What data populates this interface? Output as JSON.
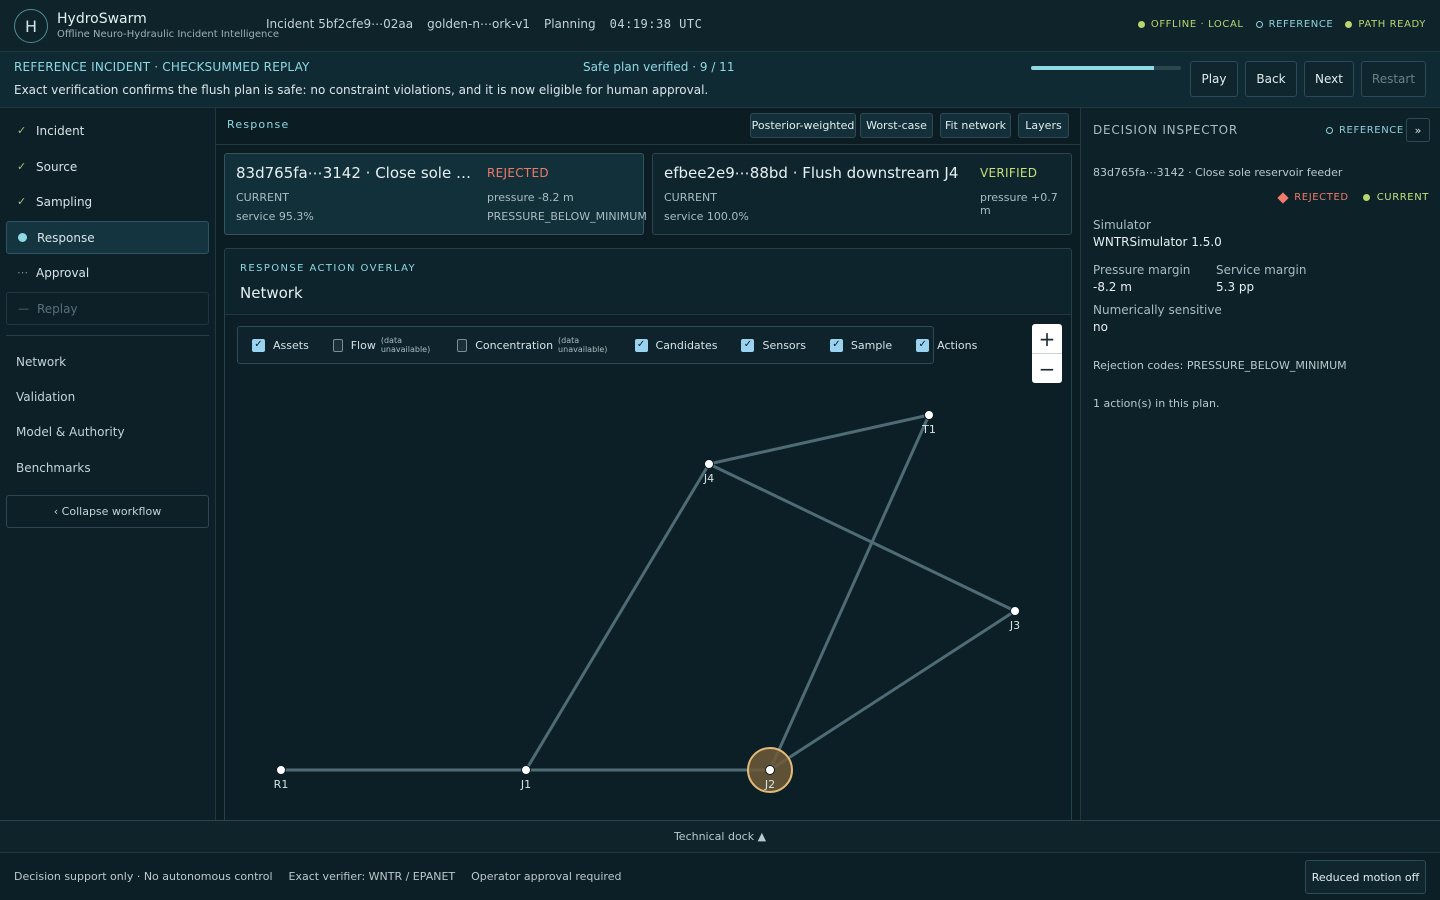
{
  "app": {
    "logo_letter": "H",
    "title": "HydroSwarm",
    "subtitle": "Offline Neuro-Hydraulic Incident Intelligence",
    "incident": "Incident 5bf2cfe9⋯02aa",
    "scenario": "golden-n⋯ork-v1",
    "phase": "Planning",
    "clock": "04:19:38 UTC",
    "status": {
      "offline": "OFFLINE · LOCAL",
      "reference": "REFERENCE",
      "path": "PATH READY"
    },
    "colors": {
      "accent": "#8fd8e4",
      "ok": "#b8d56e",
      "rejected": "#f07a6a",
      "verified": "#c9df7c"
    }
  },
  "banner": {
    "label": "REFERENCE INCIDENT · CHECKSUMMED REPLAY",
    "message": "Exact verification confirms the flush plan is safe: no constraint violations, and it is now eligible for human approval.",
    "progress_text": "Safe plan verified · 9 / 11",
    "progress_fraction": 0.818,
    "buttons": {
      "play": "Play",
      "back": "Back",
      "next": "Next",
      "restart": "Restart"
    }
  },
  "sidebar": {
    "workflow": [
      {
        "label": "Incident",
        "mark": "✓",
        "state": "done"
      },
      {
        "label": "Source",
        "mark": "✓",
        "state": "done"
      },
      {
        "label": "Sampling",
        "mark": "✓",
        "state": "done"
      },
      {
        "label": "Response",
        "mark": "",
        "state": "active"
      },
      {
        "label": "Approval",
        "mark": "⋯",
        "state": "pending"
      },
      {
        "label": "Replay",
        "mark": "—",
        "state": "disabled"
      }
    ],
    "links": [
      "Network",
      "Validation",
      "Model & Authority",
      "Benchmarks"
    ],
    "collapse_label": "‹ Collapse workflow"
  },
  "main": {
    "title": "Response",
    "tools": [
      "Posterior-weighted",
      "Worst-case",
      "Fit network",
      "Layers"
    ],
    "candidates": [
      {
        "title": "83d765fa⋯3142 · Close sole r⋯",
        "state": "CURRENT",
        "service": "service 95.3%",
        "verdict": "REJECTED",
        "pressure": "pressure -8.2 m",
        "code": "PRESSURE_BELOW_MINIMUM"
      },
      {
        "title": "efbee2e9⋯88bd · Flush downstream J4",
        "state": "CURRENT",
        "service": "service 100.0%",
        "verdict": "VERIFIED",
        "pressure": "pressure +0.7 m",
        "code": ""
      }
    ],
    "overlay": {
      "label": "RESPONSE ACTION OVERLAY",
      "title": "Network",
      "layers": [
        {
          "label": "Assets",
          "checked": true,
          "note": ""
        },
        {
          "label": "Flow",
          "checked": false,
          "note": "(data unavailable)"
        },
        {
          "label": "Concentration",
          "checked": false,
          "note": "(data unavailable)"
        },
        {
          "label": "Candidates",
          "checked": true,
          "note": ""
        },
        {
          "label": "Sensors",
          "checked": true,
          "note": ""
        },
        {
          "label": "Sample",
          "checked": true,
          "note": ""
        },
        {
          "label": "Actions",
          "checked": true,
          "note": ""
        }
      ],
      "zoom_in": "+",
      "zoom_out": "−",
      "network": {
        "nodes": [
          "R1",
          "J1",
          "J2",
          "J3",
          "J4",
          "T1"
        ],
        "edges": [
          [
            "R1",
            "J1"
          ],
          [
            "J1",
            "J2"
          ],
          [
            "J1",
            "J4"
          ],
          [
            "J4",
            "T1"
          ],
          [
            "J4",
            "J3"
          ],
          [
            "J2",
            "T1"
          ],
          [
            "J2",
            "J3"
          ]
        ],
        "highlighted_node": "J2"
      }
    }
  },
  "inspector": {
    "title": "DECISION INSPECTOR",
    "reference": "REFERENCE",
    "expand": "»",
    "subtitle": "83d765fa⋯3142 · Close sole reservoir feeder",
    "tag_rejected": "REJECTED",
    "tag_current": "CURRENT",
    "simulator_label": "Simulator",
    "simulator_value": "WNTRSimulator 1.5.0",
    "pressure_label": "Pressure margin",
    "pressure_value": "-8.2 m",
    "service_label": "Service margin",
    "service_value": "5.3 pp",
    "sensitive_label": "Numerically sensitive",
    "sensitive_value": "no",
    "rejection": "Rejection codes: PRESSURE_BELOW_MINIMUM",
    "actions": "1 action(s) in this plan."
  },
  "dock": {
    "label": "Technical dock ▲"
  },
  "footer": {
    "items": [
      "Decision support only · No autonomous control",
      "Exact verifier: WNTR / EPANET",
      "Operator approval required"
    ],
    "motion_button": "Reduced motion off"
  }
}
